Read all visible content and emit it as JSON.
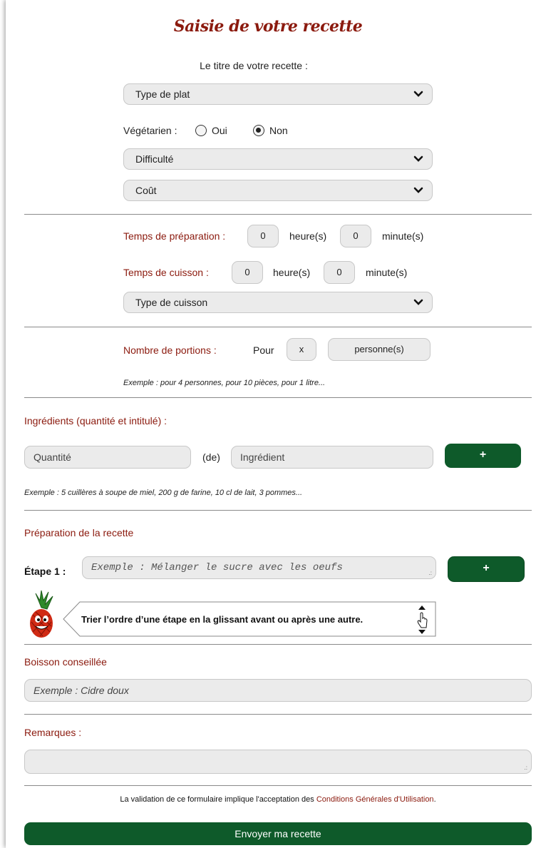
{
  "title": "Saisie de votre recette",
  "recipe_title_label": "Le titre de votre recette :",
  "selects": {
    "type_plat": "Type de plat",
    "difficulte": "Difficulté",
    "cout": "Coût",
    "type_cuisson": "Type de cuisson"
  },
  "vegetarian": {
    "label": "Végétarien :",
    "oui": "Oui",
    "non": "Non",
    "selected": "Non"
  },
  "prep_time": {
    "label": "Temps de préparation :",
    "hours_value": "0",
    "hours_label": "heure(s)",
    "minutes_value": "0",
    "minutes_label": "minute(s)"
  },
  "cook_time": {
    "label": "Temps de cuisson :",
    "hours_value": "0",
    "hours_label": "heure(s)",
    "minutes_value": "0",
    "minutes_label": "minute(s)"
  },
  "portions": {
    "label": "Nombre de portions :",
    "pour": "Pour",
    "value": "x",
    "unit": "personne(s)",
    "example": "Exemple : pour 4 personnes, pour 10 pièces, pour 1 litre..."
  },
  "ingredients": {
    "heading": "Ingrédients (quantité et intitulé) :",
    "qty_placeholder": "Quantité",
    "de": "(de)",
    "ingredient_placeholder": "Ingrédient",
    "add": "+",
    "example": "Exemple : 5 cuillères à soupe de miel, 200 g de farine, 10 cl de lait, 3 pommes..."
  },
  "preparation": {
    "heading": "Préparation de la recette",
    "step_label": "Étape 1 :",
    "step_placeholder": "Exemple : Mélanger le sucre avec les oeufs",
    "add": "+",
    "tip": "Trier l’ordre d’une étape en la glissant avant ou après une autre."
  },
  "drink": {
    "heading": "Boisson conseillée",
    "placeholder": "Exemple : Cidre doux"
  },
  "remarks": {
    "heading": "Remarques :"
  },
  "terms": {
    "prefix": "La validation de ce formulaire implique l'acceptation des ",
    "link": "Conditions Générales d'Utilisation",
    "suffix": "."
  },
  "submit": "Envoyer ma recette",
  "colors": {
    "accent_red": "#8b1a0e",
    "button_green": "#0e5a2a",
    "field_bg": "#ebebeb"
  }
}
